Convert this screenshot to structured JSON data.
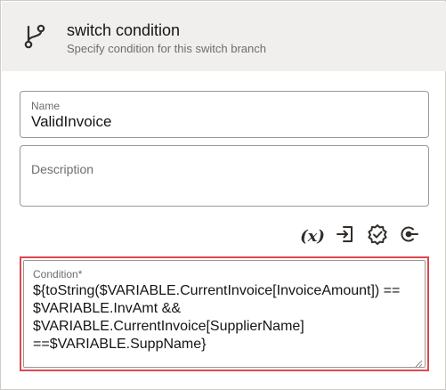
{
  "header": {
    "icon": "branch-icon",
    "title": "switch condition",
    "subtitle": "Specify condition for this switch branch"
  },
  "form": {
    "name": {
      "label": "Name",
      "value": "ValidInvoice"
    },
    "description": {
      "label": "Description",
      "value": ""
    },
    "toolbar": {
      "expression": {
        "label": "(x)",
        "icon": "variable-expression-icon"
      },
      "insert": {
        "icon": "insert-icon"
      },
      "validate": {
        "icon": "validate-badge-icon"
      },
      "clear": {
        "icon": "clear-icon"
      }
    },
    "condition": {
      "label": "Condition*",
      "value": "${toString($VARIABLE.CurrentInvoice[InvoiceAmount]) ==\n$VARIABLE.InvAmt &&\n$VARIABLE.CurrentInvoice[SupplierName]\n==$VARIABLE.SuppName}",
      "highlight_color": "#e0484e"
    }
  }
}
